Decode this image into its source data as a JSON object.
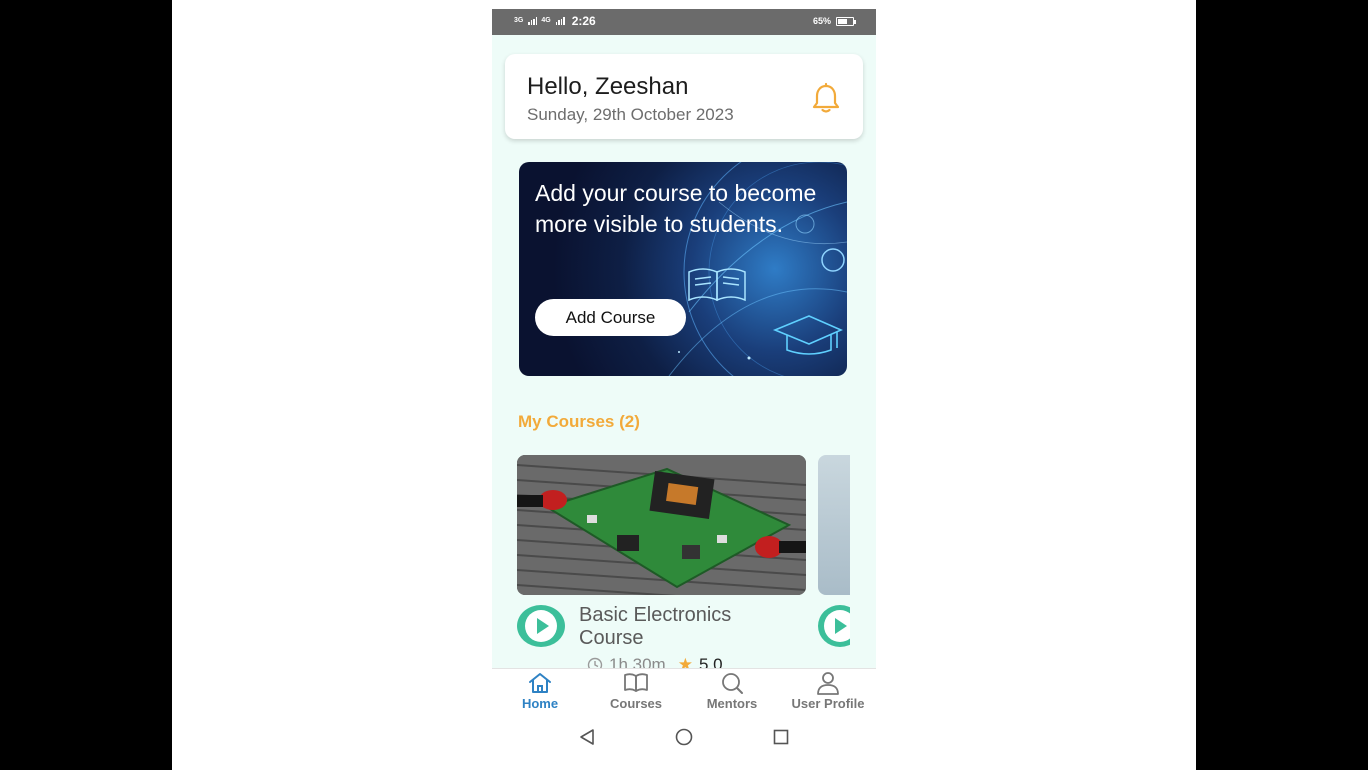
{
  "status_bar": {
    "network_1": "3G",
    "network_2": "4G",
    "time": "2:26",
    "battery_percent": "65%",
    "battery_level": 0.65
  },
  "header": {
    "greeting": "Hello, Zeeshan",
    "date": "Sunday, 29th October 2023",
    "icon": "bell-icon"
  },
  "banner": {
    "text": "Add your course to become more visible to students.",
    "button_label": "Add Course"
  },
  "my_courses": {
    "title": "My Courses (2)",
    "items": [
      {
        "title": "Basic Electronics Course",
        "duration": "1h 30m",
        "rating": "5.0"
      }
    ]
  },
  "bottom_nav": [
    {
      "label": "Home",
      "icon": "home-icon",
      "active": true
    },
    {
      "label": "Courses",
      "icon": "book-icon",
      "active": false
    },
    {
      "label": "Mentors",
      "icon": "search-icon",
      "active": false
    },
    {
      "label": "User Profile",
      "icon": "user-icon",
      "active": false
    }
  ],
  "colors": {
    "accent": "#2e82c4",
    "section_title": "#f2aa3a",
    "play": "#3cbf9a",
    "bell": "#f2aa3a",
    "background": "#eefcf8"
  }
}
